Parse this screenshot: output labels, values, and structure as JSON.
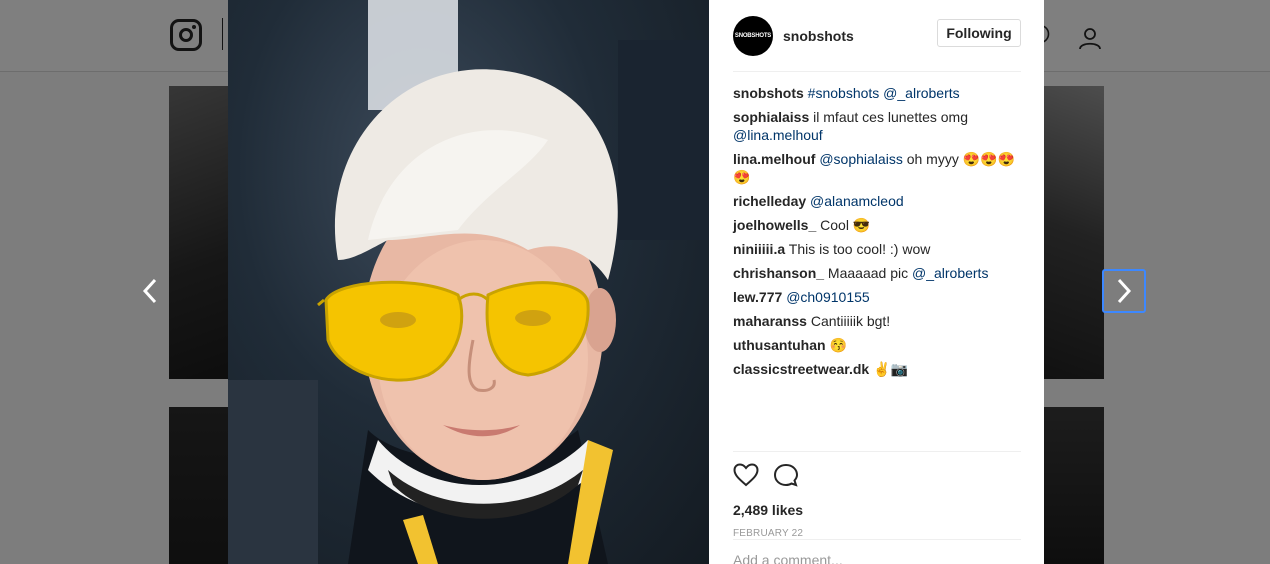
{
  "background": {
    "header": {
      "logo_icon": "instagram-logo-icon",
      "profile_icon": "profile-icon"
    }
  },
  "post": {
    "owner": {
      "username": "snobshots",
      "avatar_text": "SNOBSHOTS"
    },
    "follow_label": "Following",
    "comments": [
      {
        "user": "snobshots",
        "parts": [
          {
            "t": "#snobshots",
            "m": true
          },
          {
            "t": " ",
            "m": false
          },
          {
            "t": "@_alroberts",
            "m": true
          }
        ]
      },
      {
        "user": "sophialaiss",
        "parts": [
          {
            "t": "il mfaut ces lunettes omg ",
            "m": false
          },
          {
            "t": "@lina.melhouf",
            "m": true
          }
        ]
      },
      {
        "user": "lina.melhouf",
        "parts": [
          {
            "t": "@sophialaiss",
            "m": true
          },
          {
            "t": " oh myyy 😍😍😍😍",
            "m": false
          }
        ]
      },
      {
        "user": "richelleday",
        "parts": [
          {
            "t": "@alanamcleod",
            "m": true
          }
        ]
      },
      {
        "user": "joelhowells_",
        "parts": [
          {
            "t": "Cool 😎",
            "m": false
          }
        ]
      },
      {
        "user": "niniiiii.a",
        "parts": [
          {
            "t": "This is too cool! :) wow",
            "m": false
          }
        ]
      },
      {
        "user": "chrishanson_",
        "parts": [
          {
            "t": "Maaaaad pic ",
            "m": false
          },
          {
            "t": "@_alroberts",
            "m": true
          }
        ]
      },
      {
        "user": "lew.777",
        "parts": [
          {
            "t": "@ch0910155",
            "m": true
          }
        ]
      },
      {
        "user": "maharanss",
        "parts": [
          {
            "t": "Cantiiiiik bgt!",
            "m": false
          }
        ]
      },
      {
        "user": "uthusantuhan",
        "parts": [
          {
            "t": "😚",
            "m": false
          }
        ]
      },
      {
        "user": "classicstreetwear.dk",
        "parts": [
          {
            "t": "✌📷",
            "m": false
          }
        ]
      }
    ],
    "likes": "2,489 likes",
    "date": "FEBRUARY 22",
    "add_comment_placeholder": "Add a comment..."
  },
  "colors": {
    "mention": "#003569",
    "focus_ring": "#3d88ff"
  }
}
